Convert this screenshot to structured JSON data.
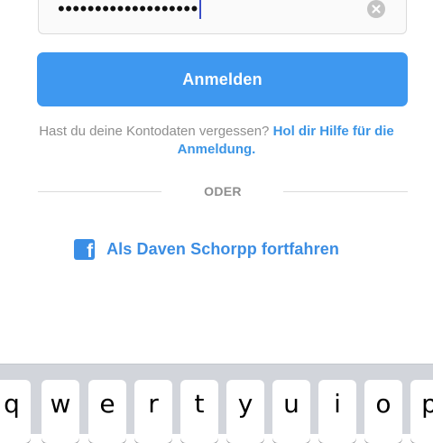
{
  "login": {
    "password_value": "•••••••••••••••••••",
    "clear_icon": "clear-circle-x-icon",
    "submit_label": "Anmelden"
  },
  "help": {
    "prefix": "Hast du deine Kontodaten vergessen? ",
    "link": "Hol dir Hilfe für die Anmeldung."
  },
  "divider": {
    "label": "ODER"
  },
  "facebook": {
    "icon": "facebook-icon",
    "icon_glyph": "f",
    "label": "Als Daven Schorpp fortfahren"
  },
  "keyboard": {
    "keys": [
      "q",
      "w",
      "e",
      "r",
      "t",
      "y",
      "u",
      "i",
      "o",
      "p"
    ]
  },
  "colors": {
    "primary_button": "#3e98f0",
    "link": "#3b95e6",
    "facebook": "#3a8ee6",
    "keyboard_bg": "#d2d5db"
  }
}
